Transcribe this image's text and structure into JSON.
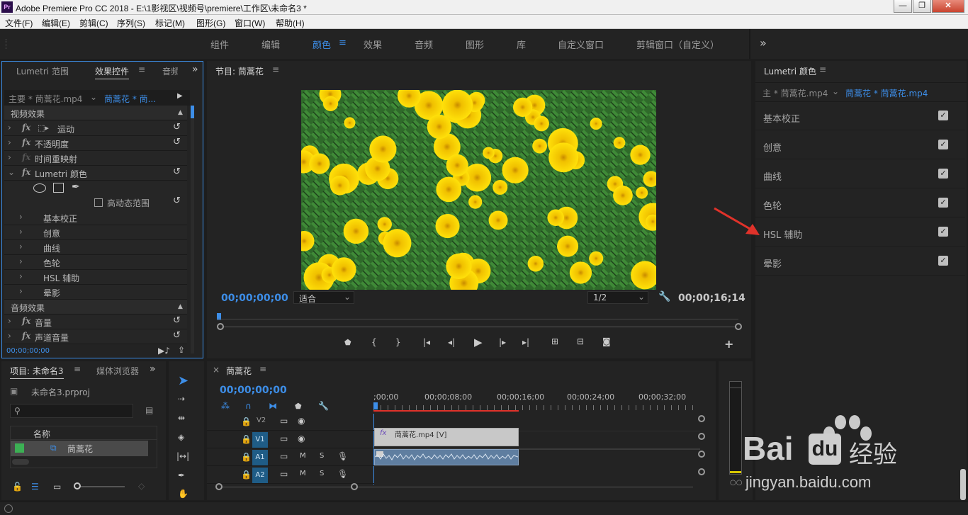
{
  "window": {
    "app_logo": "Pr",
    "title": "Adobe Premiere Pro CC 2018 - E:\\1影视区\\视频号\\premiere\\工作区\\未命名3 *",
    "controls": [
      "—",
      "❐",
      "✕"
    ]
  },
  "menu": [
    "文件(F)",
    "编辑(E)",
    "剪辑(C)",
    "序列(S)",
    "标记(M)",
    "图形(G)",
    "窗口(W)",
    "帮助(H)"
  ],
  "workspaces": {
    "items": [
      "组件",
      "编辑",
      "颜色",
      "效果",
      "音频",
      "图形",
      "库",
      "自定义窗口",
      "剪辑窗口（自定义）"
    ],
    "active": "颜色",
    "more": "»"
  },
  "effects_panel": {
    "tabs": [
      "Lumetri 范围",
      "效果控件",
      "音频"
    ],
    "active_tab": "效果控件",
    "master_clip": "主要 * 茼蒿花.mp4",
    "sequence_clip": "茼蒿花 * 茼...",
    "video_section": "视频效果",
    "video_effects": [
      "运动",
      "不透明度",
      "时间重映射",
      "Lumetri 颜色"
    ],
    "hdr_label": "高动态范围",
    "lumetri_sections": [
      "基本校正",
      "创意",
      "曲线",
      "色轮",
      "HSL 辅助",
      "晕影"
    ],
    "audio_section": "音频效果",
    "audio_effects": [
      "音量",
      "声道音量"
    ],
    "timecode": "00;00;00;00"
  },
  "program_monitor": {
    "title": "节目: 茼蒿花",
    "current_time": "00;00;00;00",
    "fit": "适合",
    "resolution": "1/2",
    "duration": "00;00;16;14"
  },
  "project_panel": {
    "tabs": [
      "项目: 未命名3",
      "媒体浏览器"
    ],
    "project_file": "未命名3.prproj",
    "column_name": "名称",
    "items": [
      "茼蒿花"
    ]
  },
  "timeline": {
    "sequence": "茼蒿花",
    "timecode": "00;00;00;00",
    "ruler_labels": [
      ";00;00",
      "00;00;08;00",
      "00;00;16;00",
      "00;00;24;00",
      "00;00;32;00"
    ],
    "tracks": [
      {
        "name": "V2"
      },
      {
        "name": "V1"
      },
      {
        "name": "A1",
        "m": "M",
        "s": "S"
      },
      {
        "name": "A2",
        "m": "M",
        "s": "S"
      }
    ],
    "video_clip": "茼蒿花.mp4 [V]",
    "clip_fx": "fx"
  },
  "lumetri_panel": {
    "title": "Lumetri 颜色",
    "master": "主 * 茼蒿花.mp4",
    "sequence": "茼蒿花 * 茼蒿花.mp4",
    "sections": [
      {
        "label": "基本校正",
        "checked": true
      },
      {
        "label": "创意",
        "checked": true
      },
      {
        "label": "曲线",
        "checked": true
      },
      {
        "label": "色轮",
        "checked": true
      },
      {
        "label": "HSL 辅助",
        "checked": true
      },
      {
        "label": "晕影",
        "checked": true
      }
    ]
  },
  "watermark": {
    "brand": "Bai",
    "brand_tail": "经验",
    "url": "jingyan.baidu.com"
  }
}
